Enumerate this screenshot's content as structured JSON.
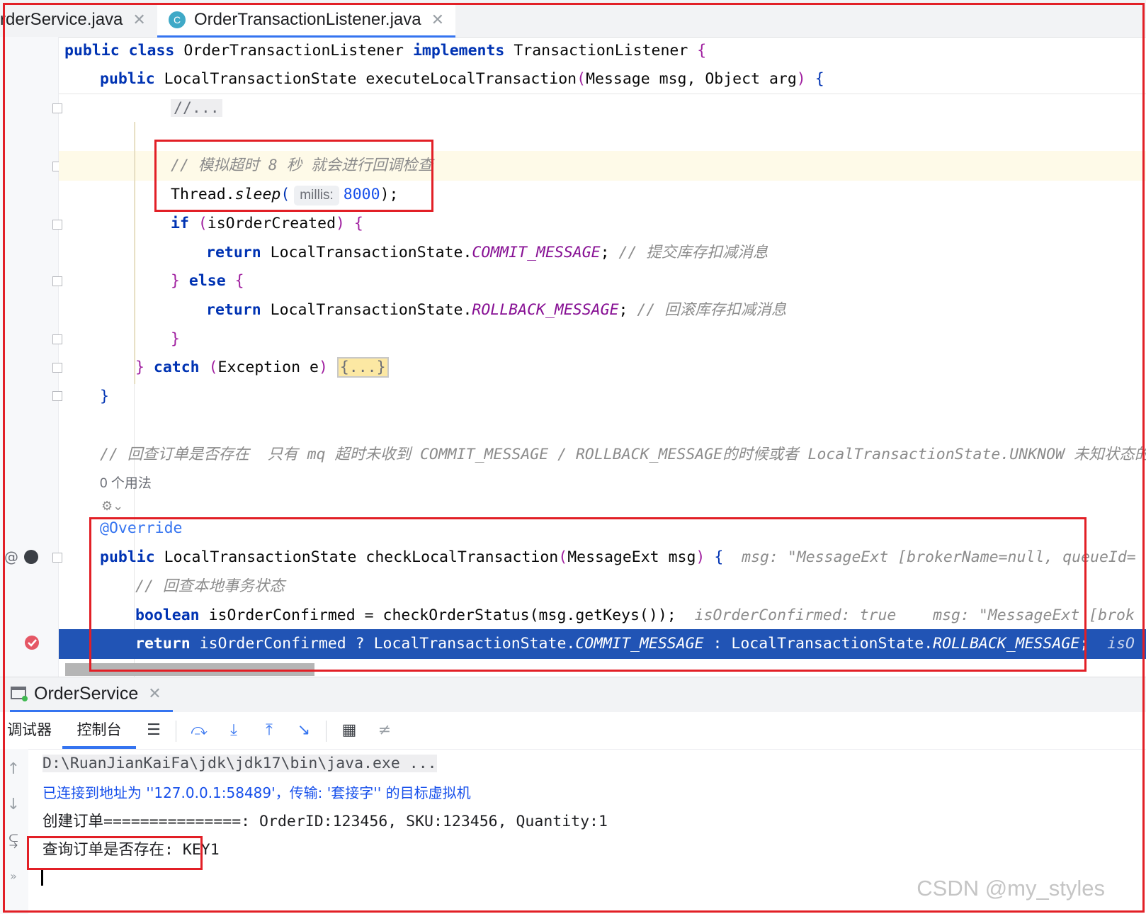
{
  "tabs": [
    {
      "label": "OrderService.java",
      "visible_label": "rderService.java",
      "active": false
    },
    {
      "label": "OrderTransactionListener.java",
      "icon": "C",
      "active": true
    }
  ],
  "code": {
    "l1": {
      "kw1": "public",
      "kw2": "class",
      "name": "OrderTransactionListener",
      "kw3": "implements",
      "iface": "TransactionListener",
      "brace": "{"
    },
    "l2": {
      "kw": "public",
      "type": "LocalTransactionState",
      "method": "executeLocalTransaction",
      "args": "Message msg, Object arg",
      "brace": "{"
    },
    "l3": {
      "folded": "//..."
    },
    "l4": {
      "comment": "// 模拟超时 8 秒 就会进行回调检查"
    },
    "l5": {
      "obj": "Thread.",
      "method": "sleep",
      "hint": "millis:",
      "value": "8000",
      "end": ");"
    },
    "l6": {
      "kw": "if",
      "cond": "isOrderCreated"
    },
    "l7": {
      "kw": "return",
      "cls": "LocalTransactionState.",
      "const": "COMMIT_MESSAGE",
      "comment": "// 提交库存扣减消息"
    },
    "l8": {
      "open": "}",
      "kw": "else",
      "brace": "{"
    },
    "l9": {
      "kw": "return",
      "cls": "LocalTransactionState.",
      "const": "ROLLBACK_MESSAGE",
      "comment": "// 回滚库存扣减消息"
    },
    "l10": {
      "brace": "}"
    },
    "l11": {
      "kw": "catch",
      "args": "Exception e",
      "folded": "{...}"
    },
    "l12": {
      "brace": "}"
    },
    "l13": {
      "comment": "// 回查订单是否存在  只有 mq 超时未收到 COMMIT_MESSAGE / ROLLBACK_MESSAGE的时候或者 LocalTransactionState.UNKNOW 未知状态的"
    },
    "usages": "0 个用法",
    "l14": {
      "annotation": "@Override"
    },
    "l15": {
      "kw": "public",
      "type": "LocalTransactionState",
      "method": "checkLocalTransaction",
      "args": "MessageExt msg",
      "brace": "{",
      "hint": "msg: \"MessageExt [brokerName=null, queueId="
    },
    "l16": {
      "comment": "// 回查本地事务状态"
    },
    "l17": {
      "kw": "boolean",
      "rest": "isOrderConfirmed = checkOrderStatus(msg.getKeys());",
      "hint1": "isOrderConfirmed: true",
      "hint2": "msg: \"MessageExt [brok"
    },
    "l18": {
      "kw": "return",
      "rest1": "isOrderConfirmed ? LocalTransactionState.",
      "const1": "COMMIT_MESSAGE",
      "rest2": " : LocalTransactionState.",
      "const2": "ROLLBACK_MESSAGE",
      "end": ";",
      "tail": "isO"
    }
  },
  "tool_window": {
    "title": "OrderService",
    "tabs": {
      "debugger": "调试器",
      "console": "控制台"
    }
  },
  "console": {
    "line1": "D:\\RuanJianKaiFa\\jdk\\jdk17\\bin\\java.exe ...",
    "line2": "已连接到地址为 ''127.0.0.1:58489'，传输: '套接字'' 的目标虚拟机",
    "line3": "创建订单===============: OrderID:123456, SKU:123456, Quantity:1",
    "line4": "查询订单是否存在: KEY1"
  },
  "watermark": "CSDN @my_styles",
  "colors": {
    "accent": "#3574f0",
    "exec_line": "#2154b5",
    "highlight_box": "#e21f26",
    "keyword": "#0033b3"
  }
}
